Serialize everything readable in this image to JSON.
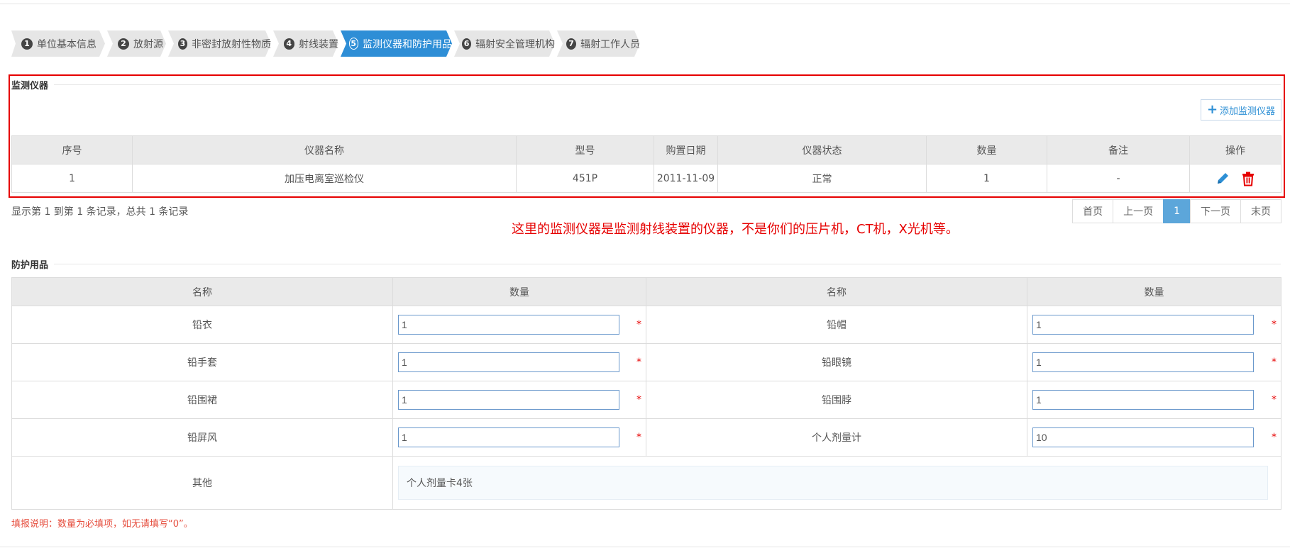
{
  "steps": [
    {
      "num": "1",
      "label": "单位基本信息",
      "active": false
    },
    {
      "num": "2",
      "label": "放射源",
      "active": false
    },
    {
      "num": "3",
      "label": "非密封放射性物质",
      "active": false
    },
    {
      "num": "4",
      "label": "射线装置",
      "active": false
    },
    {
      "num": "5",
      "label": "监测仪器和防护用品",
      "active": true
    },
    {
      "num": "6",
      "label": "辐射安全管理机构",
      "active": false
    },
    {
      "num": "7",
      "label": "辐射工作人员",
      "active": false
    }
  ],
  "colors": {
    "active_step": "#2e8ed6",
    "inactive_step": "#e6e6e6",
    "annotation": "#e60000",
    "pager_active": "#5ca6da"
  },
  "monitor": {
    "title": "监测仪器",
    "add_button": "添加监测仪器",
    "headers": [
      "序号",
      "仪器名称",
      "型号",
      "购置日期",
      "仪器状态",
      "数量",
      "备注",
      "操作"
    ],
    "rows": [
      {
        "no": "1",
        "name": "加压电离室巡检仪",
        "model": "451P",
        "date": "2011-11-09",
        "status": "正常",
        "qty": "1",
        "remark": "-"
      }
    ],
    "records_text": "显示第 1 到第 1 条记录，总共 1 条记录"
  },
  "pager": {
    "first": "首页",
    "prev": "上一页",
    "current": "1",
    "next": "下一页",
    "last": "末页"
  },
  "annotation": "这里的监测仪器是监测射线装置的仪器，不是你们的压片机，CT机，X光机等。",
  "protect": {
    "title": "防护用品",
    "headers": [
      "名称",
      "数量",
      "名称",
      "数量"
    ],
    "rows": [
      {
        "name_a": "铅衣",
        "val_a": "1",
        "name_b": "铅帽",
        "val_b": "1"
      },
      {
        "name_a": "铅手套",
        "val_a": "1",
        "name_b": "铅眼镜",
        "val_b": "1"
      },
      {
        "name_a": "铅围裙",
        "val_a": "1",
        "name_b": "铅围脖",
        "val_b": "1"
      },
      {
        "name_a": "铅屏风",
        "val_a": "1",
        "name_b": "个人剂量计",
        "val_b": "10"
      }
    ],
    "other_label": "其他",
    "other_value": "个人剂量卡4张",
    "required_mark": "*"
  },
  "note": "填报说明：数量为必填项，如无请填写“0”。"
}
